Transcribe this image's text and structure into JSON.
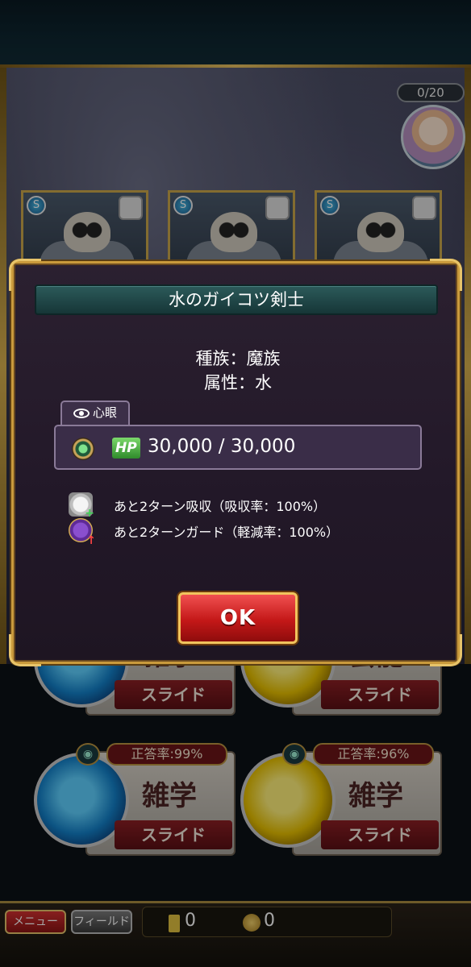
{
  "hud": {
    "progress": "0/20"
  },
  "enemies": [
    {
      "element": "water",
      "element_symbol": "S"
    },
    {
      "element": "water",
      "element_symbol": "S"
    },
    {
      "element": "water",
      "element_symbol": "S"
    }
  ],
  "answer_panels": [
    {
      "genre": "雑学",
      "slide": "スライド",
      "rate": "",
      "element": "water"
    },
    {
      "genre": "芸能",
      "slide": "スライド",
      "rate": "",
      "element": "thunder"
    },
    {
      "genre": "雑学",
      "slide": "スライド",
      "rate": "正答率:99%",
      "element": "water"
    },
    {
      "genre": "雑学",
      "slide": "スライド",
      "rate": "正答率:96%",
      "element": "thunder"
    }
  ],
  "bottom_bar": {
    "menu_label": "メニュー",
    "field_label": "フィールド",
    "gem_count": "0",
    "coin_count": "0"
  },
  "modal": {
    "title": "水のガイコツ剣士",
    "tribe": "種族：魔族",
    "attribute": "属性：水",
    "shingan_tab": "心眼",
    "hp_label": "HP",
    "hp_value": "30,000 / 30,000",
    "effects": [
      {
        "icon": "absorb-icon",
        "text": "あと2ターン吸収（吸収率：100%）"
      },
      {
        "icon": "guard-icon",
        "text": "あと2ターンガード（軽減率：100%）"
      }
    ],
    "ok_label": "OK"
  },
  "colors": {
    "frame_gold": "#c99a3c",
    "title_teal": "#2c5a5a",
    "ok_red": "#c41818",
    "hp_green": "#2f8a2b"
  }
}
